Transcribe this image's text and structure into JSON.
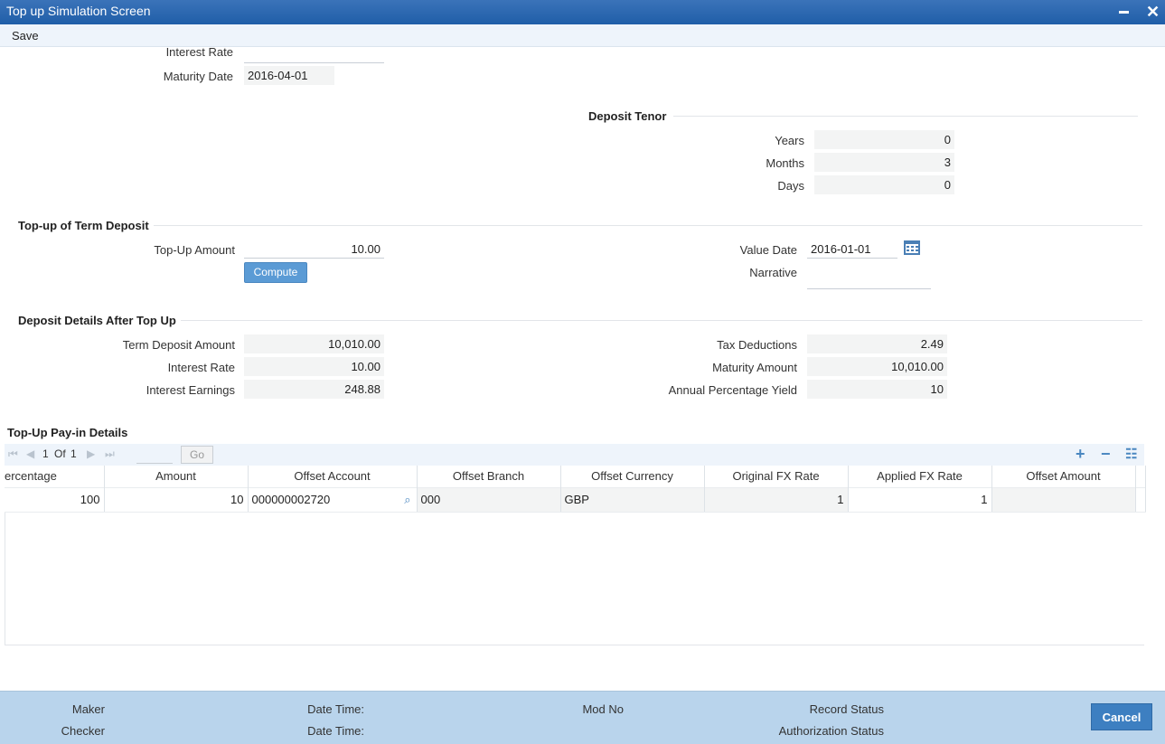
{
  "window": {
    "title": "Top up Simulation Screen"
  },
  "toolbar": {
    "save_label": "Save"
  },
  "top_fields": {
    "interest_rate_label": "Interest Rate",
    "maturity_date_label": "Maturity Date",
    "maturity_date_value": "2016-04-01"
  },
  "deposit_tenor": {
    "title": "Deposit Tenor",
    "years_label": "Years",
    "years_value": "0",
    "months_label": "Months",
    "months_value": "3",
    "days_label": "Days",
    "days_value": "0"
  },
  "topup": {
    "title": "Top-up of Term Deposit",
    "amount_label": "Top-Up Amount",
    "amount_value": "10.00",
    "compute_label": "Compute",
    "value_date_label": "Value Date",
    "value_date_value": "2016-01-01",
    "narrative_label": "Narrative",
    "narrative_value": ""
  },
  "after_topup": {
    "title": "Deposit Details After Top Up",
    "term_deposit_amount_label": "Term Deposit Amount",
    "term_deposit_amount_value": "10,010.00",
    "interest_rate_label": "Interest Rate",
    "interest_rate_value": "10.00",
    "interest_earnings_label": "Interest Earnings",
    "interest_earnings_value": "248.88",
    "tax_deductions_label": "Tax Deductions",
    "tax_deductions_value": "2.49",
    "maturity_amount_label": "Maturity Amount",
    "maturity_amount_value": "10,010.00",
    "apy_label": "Annual Percentage Yield",
    "apy_value": "10"
  },
  "payin": {
    "title": "Top-Up Pay-in Details",
    "page_current": "1",
    "page_of": "Of",
    "page_total": "1",
    "go_label": "Go",
    "columns": [
      "ercentage",
      "Amount",
      "Offset Account",
      "Offset Branch",
      "Offset Currency",
      "Original FX Rate",
      "Applied FX Rate",
      "Offset Amount"
    ],
    "rows": [
      {
        "percentage": "100",
        "amount": "10",
        "offset_account": "000000002720",
        "offset_branch": "000",
        "offset_currency": "GBP",
        "original_fx": "1",
        "applied_fx": "1",
        "offset_amount": ""
      }
    ]
  },
  "footer": {
    "maker_label": "Maker",
    "checker_label": "Checker",
    "date_time_label_1": "Date Time:",
    "date_time_label_2": "Date Time:",
    "mod_no_label": "Mod No",
    "record_status_label": "Record Status",
    "authorization_status_label": "Authorization Status",
    "cancel_label": "Cancel"
  }
}
